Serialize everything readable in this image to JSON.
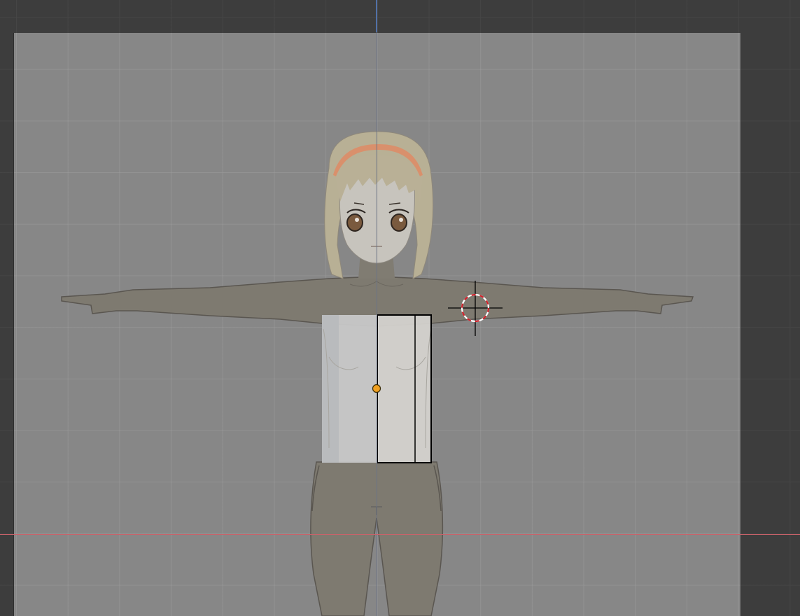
{
  "viewport": {
    "view": "front-orthographic",
    "grid": true,
    "colors": {
      "background": "#3d3d3d",
      "reference_image": "#878787",
      "x_axis": "#c9626a",
      "z_axis": "#3f6fbf",
      "selected_outline": "#000000",
      "origin": "#f0a020"
    }
  },
  "scene": {
    "reference": "character-reference-image",
    "mesh": "box-mesh",
    "selection": "selected-box-half",
    "cursor": "3d-cursor-icon",
    "origin": "object-origin-icon"
  }
}
